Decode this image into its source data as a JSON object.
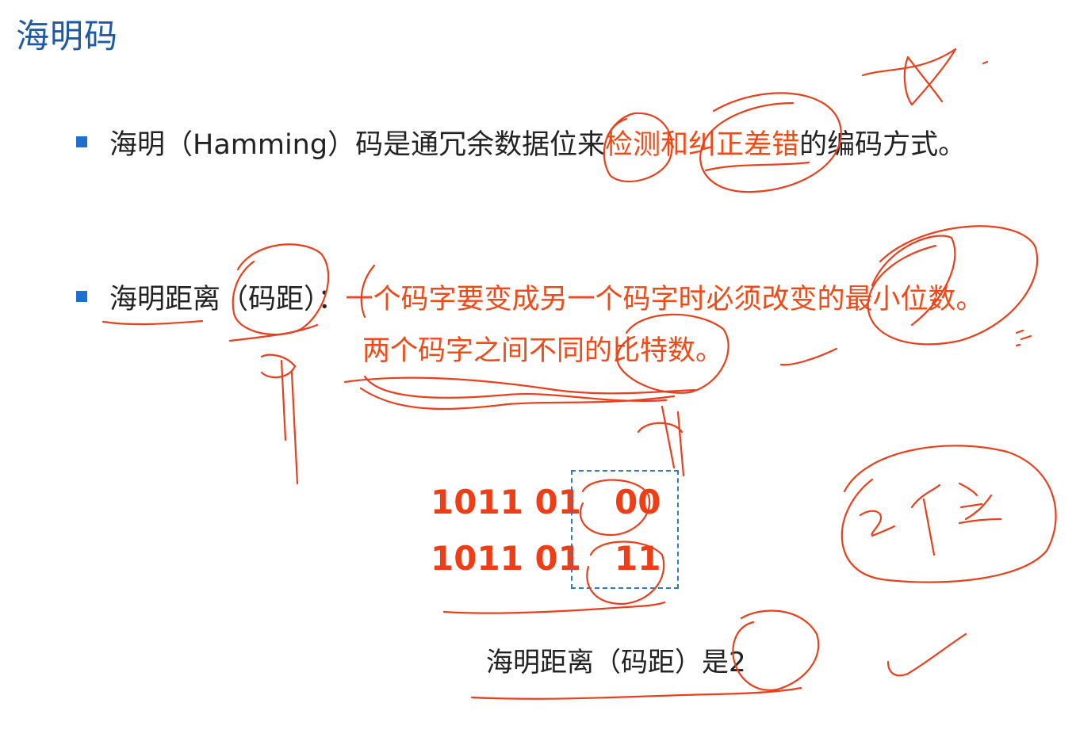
{
  "title": "海明码",
  "bullets": [
    {
      "prefix": "海明（Hamming）码是通冗余数据位来",
      "highlight": "检测和纠正差错",
      "suffix": "的编码方式。"
    },
    {
      "prefix": "海明距离（码距）：",
      "highlight": "一个码字要变成另一个码字时必须改变的最小位数。",
      "line2": "两个码字之间不同的比特数。"
    }
  ],
  "example": {
    "code1_prefix": "1011 01",
    "code1_suffix": "00",
    "code2_prefix": "1011 01",
    "code2_suffix": "11",
    "caption": "海明距离（码距）是2"
  },
  "colors": {
    "title": "#1c5aa6",
    "bullet": "#1f6fd1",
    "highlight": "#f24a17",
    "ink": "#e8401c",
    "dashbox": "#2f79c9"
  }
}
